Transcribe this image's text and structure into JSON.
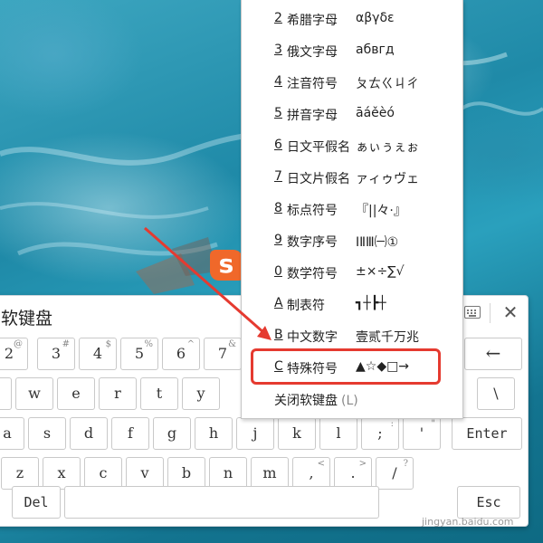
{
  "colors": {
    "accent_red": "#e53a30",
    "logo_orange": "#f0682a"
  },
  "logo": {
    "text": "s"
  },
  "keyboard": {
    "title": "软键盘",
    "close_glyph": "✕",
    "rows": [
      [
        {
          "main": "2",
          "shift": "@"
        },
        {
          "main": "3",
          "shift": "#"
        },
        {
          "main": "4",
          "shift": "$"
        },
        {
          "main": "5",
          "shift": "%"
        },
        {
          "main": "6",
          "shift": "^"
        },
        {
          "main": "7",
          "shift": "&"
        },
        {
          "main": "←",
          "shift": ""
        }
      ],
      [
        {
          "main": "w"
        },
        {
          "main": "e"
        },
        {
          "main": "r"
        },
        {
          "main": "t"
        },
        {
          "main": "y"
        },
        {
          "main": "\\",
          "shift": ""
        }
      ],
      [
        {
          "main": "a"
        },
        {
          "main": "s"
        },
        {
          "main": "d"
        },
        {
          "main": "f"
        },
        {
          "main": "g"
        },
        {
          "main": "h"
        },
        {
          "main": "j"
        },
        {
          "main": "k"
        },
        {
          "main": "l"
        },
        {
          "main": ";",
          "shift": ":"
        },
        {
          "main": "'",
          "shift": "\""
        },
        {
          "main": "Enter"
        }
      ],
      [
        {
          "main": "z"
        },
        {
          "main": "x"
        },
        {
          "main": "c"
        },
        {
          "main": "v"
        },
        {
          "main": "b"
        },
        {
          "main": "n"
        },
        {
          "main": "m"
        },
        {
          "main": ",",
          "shift": "<"
        },
        {
          "main": ".",
          "shift": ">"
        },
        {
          "main": "/",
          "shift": "?"
        }
      ],
      [
        {
          "main": "Del"
        },
        {
          "main": ""
        },
        {
          "main": "Esc"
        }
      ]
    ]
  },
  "menu": {
    "items": [
      {
        "num": "2",
        "label": "希腊字母",
        "sample": "αβγδε"
      },
      {
        "num": "3",
        "label": "俄文字母",
        "sample": "абвгд"
      },
      {
        "num": "4",
        "label": "注音符号",
        "sample": "ㄆㄊㄍㄐㄔ"
      },
      {
        "num": "5",
        "label": "拼音字母",
        "sample": "āáěèó"
      },
      {
        "num": "6",
        "label": "日文平假名",
        "sample": "ぁぃぅぇぉ"
      },
      {
        "num": "7",
        "label": "日文片假名",
        "sample": "ァィゥヴェ"
      },
      {
        "num": "8",
        "label": "标点符号",
        "sample": "『||々·』"
      },
      {
        "num": "9",
        "label": "数字序号",
        "sample": "ⅠⅡⅢ㈠①"
      },
      {
        "num": "0",
        "label": "数学符号",
        "sample": "±×÷∑√"
      },
      {
        "num": "A",
        "label": "制表符",
        "sample": "┓┼┣┼"
      },
      {
        "num": "B",
        "label": "中文数字",
        "sample": "壹贰千万兆"
      },
      {
        "num": "C",
        "label": "特殊符号",
        "sample": "▲☆◆□→"
      }
    ],
    "close_label": "关闭软键盘",
    "close_shortcut": "(L)"
  },
  "watermark": "jingyan.baidu.com"
}
